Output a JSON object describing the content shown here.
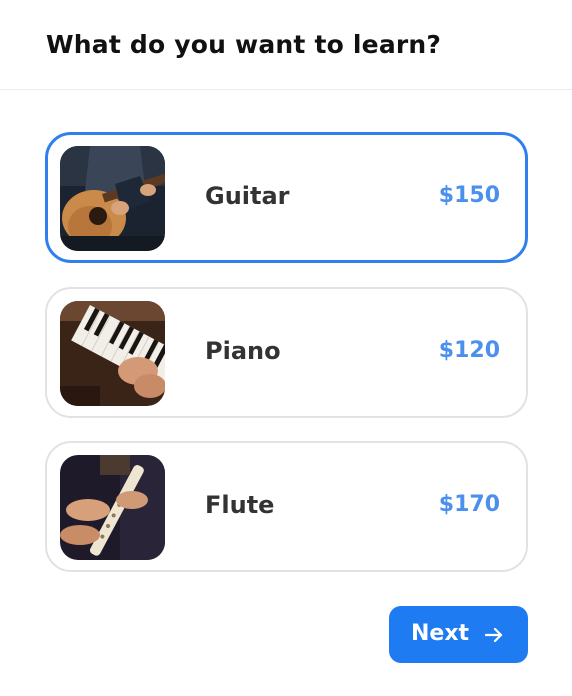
{
  "header": {
    "title": "What do you want to learn?"
  },
  "options": [
    {
      "label": "Guitar",
      "price": "$150",
      "selected": true,
      "icon": "guitar-photo"
    },
    {
      "label": "Piano",
      "price": "$120",
      "selected": false,
      "icon": "piano-photo"
    },
    {
      "label": "Flute",
      "price": "$170",
      "selected": false,
      "icon": "flute-photo"
    }
  ],
  "actions": {
    "next_label": "Next",
    "next_icon": "arrow-right-icon"
  },
  "colors": {
    "accent": "#1f7bf2",
    "selected_border": "#2f7ff0",
    "price": "#4a90ec",
    "card_border": "#e2e2e2",
    "title": "#111111",
    "label": "#333333"
  }
}
